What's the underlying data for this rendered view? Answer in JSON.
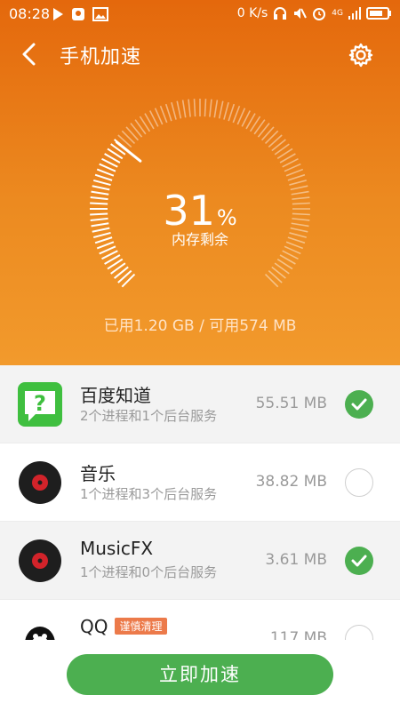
{
  "status_bar": {
    "time": "08:28",
    "net_speed": "0 K/s",
    "signal": "4G"
  },
  "header": {
    "title": "手机加速"
  },
  "gauge": {
    "percent": "31",
    "unit": "%",
    "label": "内存剩余",
    "fraction_remaining": 0.31
  },
  "memory": {
    "text": "已用1.20 GB / 可用574 MB"
  },
  "apps": [
    {
      "name": "百度知道",
      "desc": "2个进程和1个后台服务",
      "size": "55.51 MB",
      "checked": true
    },
    {
      "name": "音乐",
      "desc": "1个进程和3个后台服务",
      "size": "38.82 MB",
      "checked": false
    },
    {
      "name": "MusicFX",
      "desc": "1个进程和0个后台服务",
      "size": "3.61 MB",
      "checked": true
    },
    {
      "name": "QQ",
      "badge": "谨慎清理",
      "desc": "",
      "size": "117 MB",
      "checked": false
    }
  ],
  "action": {
    "button_label": "立即加速"
  },
  "colors": {
    "header_top": "#e4680c",
    "header_bottom": "#f29a2c",
    "accent_green": "#4caf50",
    "badge": "#ec7a4a"
  }
}
